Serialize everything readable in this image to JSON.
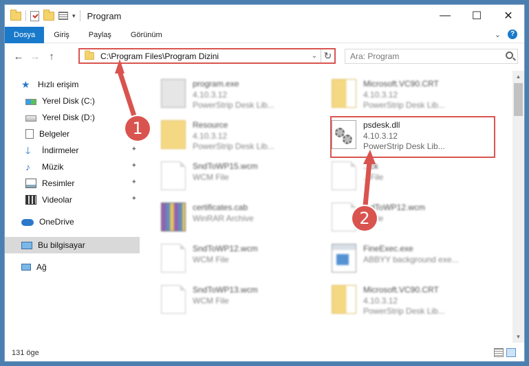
{
  "window": {
    "title": "Program",
    "controls": {
      "minimize": "—",
      "maximize": "☐",
      "close": "✕"
    }
  },
  "ribbon": {
    "tabs": [
      "Dosya",
      "Giriş",
      "Paylaş",
      "Görünüm"
    ],
    "expand_glyph": "⌄",
    "help_glyph": "?"
  },
  "nav": {
    "back": "←",
    "forward": "→",
    "up": "↑",
    "address": "C:\\Program Files\\Program Dizini",
    "dropdown_glyph": "⌄",
    "refresh_glyph": "↻",
    "search_placeholder": "Ara: Program"
  },
  "sidebar": {
    "items": [
      {
        "label": "Hızlı erişim",
        "icon": "star-icon"
      },
      {
        "label": "Yerel Disk (C:)",
        "icon": "drive-icon"
      },
      {
        "label": "Yerel Disk (D:)",
        "icon": "drive-icon"
      },
      {
        "label": "Belgeler",
        "icon": "documents-icon"
      },
      {
        "label": "İndirmeler",
        "icon": "downloads-icon",
        "pinned": true
      },
      {
        "label": "Müzik",
        "icon": "music-icon",
        "pinned": true
      },
      {
        "label": "Resimler",
        "icon": "pictures-icon",
        "pinned": true
      },
      {
        "label": "Videolar",
        "icon": "videos-icon",
        "pinned": true
      },
      {
        "label": "OneDrive",
        "icon": "onedrive-icon"
      },
      {
        "label": "Bu bilgisayar",
        "icon": "this-pc-icon",
        "selected": true
      },
      {
        "label": "Ağ",
        "icon": "network-icon"
      }
    ],
    "pin_glyph": "📌"
  },
  "files": [
    {
      "name": "program.exe",
      "line2": "4.10.3.12",
      "line3": "PowerStrip Desk Lib...",
      "kind": "exe",
      "blurred": true
    },
    {
      "name": "Microsoft.VC90.CRT",
      "line2": "4.10.3.12",
      "line3": "PowerStrip Desk Lib...",
      "kind": "folder2",
      "blurred": true
    },
    {
      "name": "Resource",
      "line2": "4.10.3.12",
      "line3": "PowerStrip Desk Lib...",
      "kind": "folder",
      "blurred": true
    },
    {
      "name": "psdesk.dll",
      "line2": "4.10.3.12",
      "line3": "PowerStrip Desk Lib...",
      "kind": "dll",
      "blurred": false
    },
    {
      "name": "SndToWP15.wcm",
      "line2": "WCM File",
      "line3": "",
      "kind": "page",
      "blurred": true
    },
    {
      "name": "...ck",
      "line2": "...File",
      "line3": "",
      "kind": "page",
      "blurred": true
    },
    {
      "name": "certificates.cab",
      "line2": "WinRAR Archive",
      "line3": "",
      "kind": "cab",
      "blurred": true
    },
    {
      "name": "...dToWP12.wcm",
      "line2": "...File",
      "line3": "",
      "kind": "page",
      "blurred": true
    },
    {
      "name": "SndToWP12.wcm",
      "line2": "WCM File",
      "line3": "",
      "kind": "page",
      "blurred": true
    },
    {
      "name": "FineExec.exe",
      "line2": "ABBYY background exe...",
      "line3": "",
      "kind": "fine",
      "blurred": true
    },
    {
      "name": "SndToWP13.wcm",
      "line2": "WCM File",
      "line3": "",
      "kind": "page",
      "blurred": true
    },
    {
      "name": "Microsoft.VC90.CRT",
      "line2": "4.10.3.12",
      "line3": "PowerStrip Desk Lib...",
      "kind": "folder2",
      "blurred": true
    }
  ],
  "status": {
    "count": "131 öge"
  },
  "annotations": {
    "step1": "1",
    "step2": "2",
    "color": "#d9534f"
  }
}
